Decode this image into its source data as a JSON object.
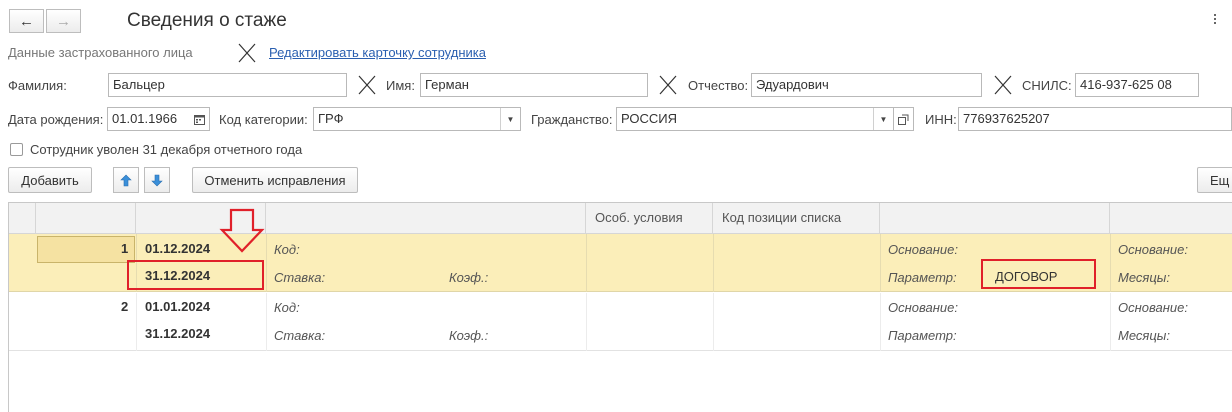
{
  "window": {
    "title": "Сведения о стаже",
    "back_glyph": "←",
    "forward_glyph": "→"
  },
  "insured": {
    "section_label": "Данные застрахованного лица",
    "edit_link": "Редактировать карточку сотрудника",
    "surname_label": "Фамилия:",
    "surname_value": "Бальцер",
    "name_label": "Имя:",
    "name_value": "Герман",
    "patronymic_label": "Отчество:",
    "patronymic_value": "Эдуардович",
    "snils_label": "СНИЛС:",
    "snils_value": "416-937-625 08",
    "birth_label": "Дата рождения:",
    "birth_value": "01.01.1966",
    "category_label": "Код категории:",
    "category_value": "ГРФ",
    "citizenship_label": "Гражданство:",
    "citizenship_value": "РОССИЯ",
    "inn_label": "ИНН:",
    "inn_value": "776937625207",
    "dismissed_label": "Сотрудник уволен 31 декабря отчетного года",
    "dismissed_checked": false
  },
  "toolbar": {
    "add_label": "Добавить",
    "cancel_fix_label": "Отменить исправления",
    "more_label": "Ещ"
  },
  "table": {
    "headers": {
      "special_conditions": "Особ. условия",
      "list_position_code": "Код позиции списка"
    },
    "rows": [
      {
        "num": "1",
        "date_from": "01.12.2024",
        "date_to": "31.12.2024",
        "code_label": "Код:",
        "rate_label": "Ставка:",
        "coef_label": "Коэф.:",
        "basis_label": "Основание:",
        "param_label": "Параметр:",
        "param_value": "ДОГОВОР",
        "basis2_label": "Основание:",
        "months_label": "Месяцы:"
      },
      {
        "num": "2",
        "date_from": "01.01.2024",
        "date_to": "31.12.2024",
        "code_label": "Код:",
        "rate_label": "Ставка:",
        "coef_label": "Коэф.:",
        "basis_label": "Основание:",
        "param_label": "Параметр:",
        "basis2_label": "Основание:",
        "months_label": "Месяцы:"
      }
    ]
  },
  "colors": {
    "selected_row": "#fbeeb9",
    "annotation_red": "#e0202a",
    "link_blue": "#2a5fb0"
  }
}
